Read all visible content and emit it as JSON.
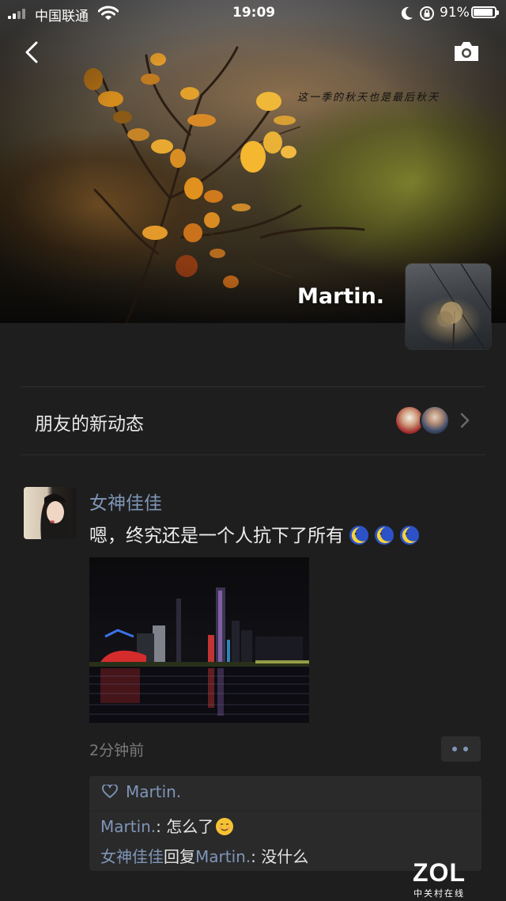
{
  "status_bar": {
    "carrier": "中国联通",
    "time": "19:09",
    "battery_percent": "91%",
    "signal_icon": "signal-icon",
    "wifi_icon": "wifi-icon",
    "moon_icon": "do-not-disturb-icon",
    "lock_icon": "rotation-lock-icon"
  },
  "header": {
    "back_icon": "chevron-left-icon",
    "camera_icon": "camera-icon"
  },
  "cover": {
    "overlay_text": "这一季的秋天也是最后秋天",
    "user_name": "Martin."
  },
  "friends_updates": {
    "label": "朋友的新动态",
    "avatar_count": 2,
    "chevron_icon": "chevron-right-icon"
  },
  "post": {
    "author": "女神佳佳",
    "text": "嗯，终究还是一个人抗下了所有",
    "emoji": [
      "moon-face-emoji",
      "moon-face-emoji",
      "moon-face-emoji"
    ],
    "time": "2分钟前",
    "more_icon": "more-dots-icon",
    "likes": {
      "icon": "heart-icon",
      "names": "Martin."
    },
    "comments": [
      {
        "user": "Martin.",
        "separator": ": ",
        "text": "怎么了",
        "emoji": "smiling-face-emoji"
      },
      {
        "user": "女神佳佳",
        "reply_word": "回复",
        "reply_to": "Martin.",
        "separator": ": ",
        "text": "没什么"
      }
    ]
  },
  "watermark": {
    "brand": "ZOL",
    "subtitle": "中关村在线"
  }
}
